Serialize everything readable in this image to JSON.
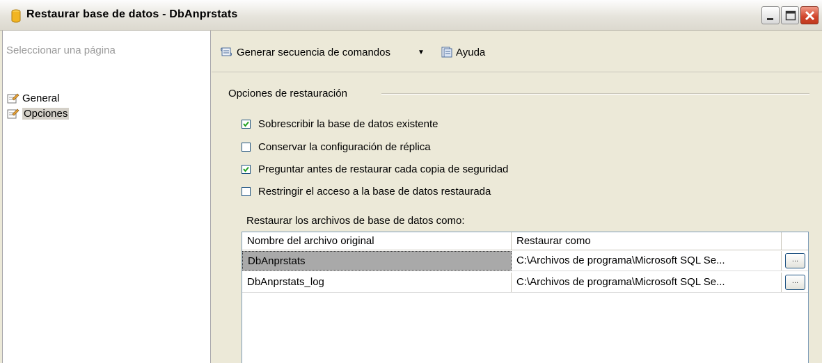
{
  "window": {
    "title": "Restaurar base de datos - DbAnprstats",
    "icon": "database-icon"
  },
  "left_pane": {
    "header": "Seleccionar una página",
    "items": [
      {
        "label": "General",
        "icon": "page-icon",
        "selected": false
      },
      {
        "label": "Opciones",
        "icon": "page-icon",
        "selected": true
      }
    ]
  },
  "toolbar": {
    "script_label": "Generar secuencia de comandos",
    "help_label": "Ayuda",
    "dropdown_glyph": "▼"
  },
  "options": {
    "group_label": "Opciones de restauración",
    "checkboxes": [
      {
        "label": "Sobrescribir la base de datos existente",
        "checked": true
      },
      {
        "label": "Conservar la configuración de réplica",
        "checked": false
      },
      {
        "label": "Preguntar antes de restaurar cada copia de seguridad",
        "checked": true
      },
      {
        "label": "Restringir el acceso a la base de datos restaurada",
        "checked": false
      }
    ]
  },
  "files": {
    "label": "Restaurar los archivos de base de datos como:",
    "headers": [
      "Nombre del archivo original",
      "Restaurar como"
    ],
    "rows": [
      {
        "original": "DbAnprstats",
        "restore_as": "C:\\Archivos de programa\\Microsoft SQL Se...",
        "browse": "...",
        "selected": true
      },
      {
        "original": "DbAnprstats_log",
        "restore_as": "C:\\Archivos de programa\\Microsoft SQL Se...",
        "browse": "...",
        "selected": false
      }
    ]
  },
  "colors": {
    "title_bg": "#e6e4dc",
    "selection": "#a9a9a9",
    "check": "#21a121",
    "border": "#7f9db9"
  }
}
